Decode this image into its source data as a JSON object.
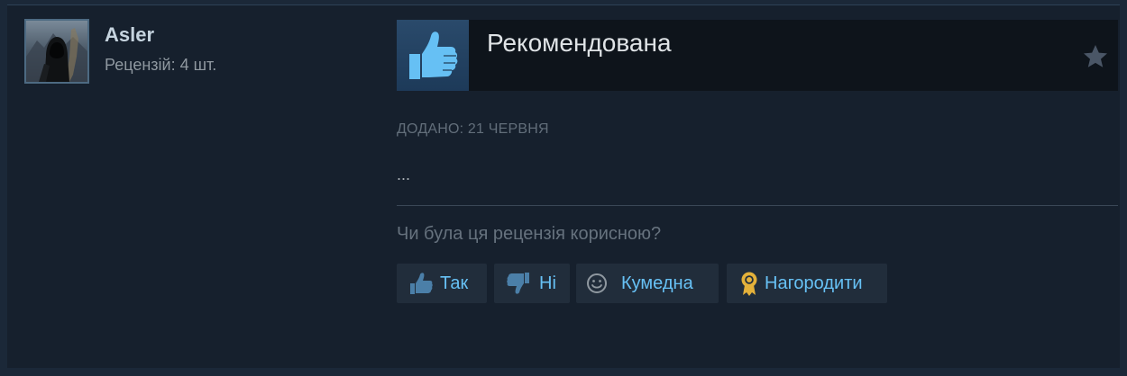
{
  "author": {
    "name": "Asler",
    "review_count": "Рецензій: 4 шт."
  },
  "review": {
    "verdict": "Рекомендована",
    "date_posted": "ДОДАНО: 21 ЧЕРВНЯ",
    "body": "...",
    "helpful_question": "Чи була ця рецензія корисною?"
  },
  "actions": {
    "yes_label": "Так",
    "no_label": "Ні",
    "funny_label": "Кумедна",
    "award_label": "Нагородити"
  },
  "icons": {
    "verdict": "thumbs-up-icon",
    "favorite": "star-icon",
    "yes": "thumbs-up-icon",
    "no": "thumbs-down-icon",
    "funny": "smiley-icon",
    "award": "award-ribbon-icon"
  },
  "colors": {
    "background": "#1b2838",
    "card": "#16202d",
    "link_blue": "#67c1f5",
    "thumb_blue": "#66c0f4",
    "award_gold": "#e4b13a"
  }
}
